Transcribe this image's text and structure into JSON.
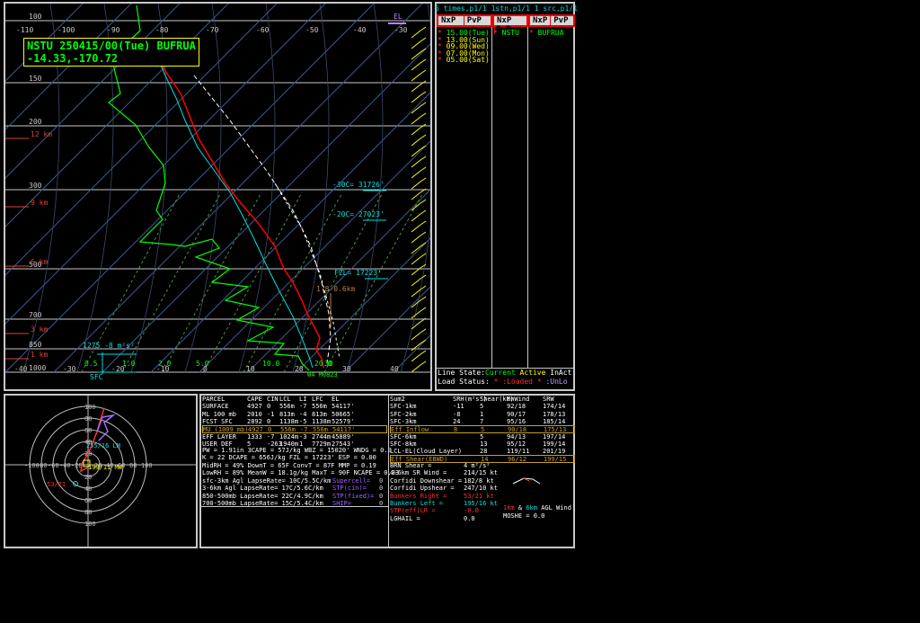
{
  "skewt": {
    "title_line1": "NSTU 250415/00(Tue) BUFRUA",
    "title_line2": "-14.33,-170.72",
    "temp_ticks": [
      "-110",
      "-100",
      "-90",
      "-80",
      "-70",
      "-60",
      "-50",
      "-40",
      "-30"
    ],
    "bottom_ticks": [
      "-40",
      "-30",
      "-20",
      "-10",
      "0",
      "10",
      "20",
      "30",
      "40"
    ],
    "pressure_labels": [
      "100",
      "150",
      "200",
      "300",
      "500",
      "700",
      "850",
      "1000"
    ],
    "height_labels": [
      "12 km",
      "9 km",
      "6 km",
      "3 km",
      "1 km"
    ],
    "sfc_label": "SFC",
    "mixing_ratios": [
      "0.5",
      "1.0",
      "2.0",
      "5.0",
      "10.0",
      "20.0",
      "30"
    ],
    "level_labels": [
      {
        "text": "-30C= 31726'"
      },
      {
        "text": "-20C= 27023'"
      },
      {
        "text": "FZL= 17223'"
      }
    ],
    "el_label": "EL",
    "eff_inflow_label": "1275  -8 m²s²",
    "layer_label": "1.8-0.6km",
    "sfc_val": "W4 M0823 ",
    "colors": {
      "temp": "#ff0000",
      "dew": "#00ff00",
      "wetbulb": "#00e0e0",
      "parcel": "#ffffff",
      "wind": "#ffff00"
    }
  },
  "rightlist": {
    "header": "5 times,p1/1 1stn,p1/1 1 src,p1/1",
    "buttons": [
      "NxP",
      "PvP",
      "NxP",
      "PvP",
      "NxP",
      "PvP"
    ],
    "times": [
      "15.00(Tue)",
      "13.00(Sun)",
      "09.00(Wed)",
      "07.00(Mon)",
      "05.00(Sat)"
    ],
    "station": "NSTU",
    "source": "BUFRUA",
    "line_state_label": "Line State:",
    "line_state_current": "Current",
    "line_state_active": "Active",
    "line_state_inact": "InAct",
    "load_status_label": "Load Status:",
    "load_loaded": ":Loaded",
    "load_unlo": ":UnLo"
  },
  "hodo": {
    "rings": [
      "20",
      "40",
      "60",
      "80",
      "100"
    ],
    "axis": [
      "-100",
      "-80",
      "-60",
      "-40",
      "-20",
      "20",
      "40",
      "60",
      "80",
      "100"
    ],
    "lm_label": "255/16 LM",
    "rm_label": "53/21 RM",
    "mean_label": "199/11 MW",
    "bunkers_label": "53/21"
  },
  "params": {
    "left_head": [
      "PARCEL",
      "CAPE",
      "CIN",
      "LCL",
      "LI",
      "LFC",
      "EL"
    ],
    "left_rows": [
      [
        "SURFACE",
        "4927",
        "0",
        "556m",
        "-7",
        "556m",
        "54117'"
      ],
      [
        "ML 100 mb",
        "2010",
        "-1",
        "813m",
        "-4",
        "813m",
        "50665'"
      ],
      [
        "FCST SFC",
        "2892",
        "0",
        "1138m",
        "-5",
        "1138m",
        "52579'"
      ],
      [
        "MU (1009 mb)",
        "4927",
        "0",
        "556m",
        "-7",
        "556m",
        "54117'"
      ],
      [
        "EFF LAYER",
        "1333",
        "-7",
        "1024m",
        "-3",
        "2744m",
        "45889'"
      ],
      [
        "USER DEF",
        "5",
        "-263",
        "1940m",
        "1",
        "7729m",
        "27543'"
      ]
    ],
    "misc_rows": [
      "PW = 1.91in  3CAPE = 57J/kg  WBZ = 15020'  WNDG = 0.0",
      "K = 22       DCAPE = 656J/kg  FZL = 17223'  ESP = 0.00",
      "MidRH = 49%  DownT = 65F   ConvT = 87F  MMP = 0.19",
      "LowRH = 89%  MeanW = 18.1g/kg  MaxT = 90F  NCAPE = 0.33"
    ],
    "lapse_rows": [
      "sfc-3km Agl LapseRate= 10C/5.5C/km",
      "3-6km Agl LapseRate= 17C/5.6C/km",
      "850-500mb LapseRate= 22C/4.9C/km",
      "700-500mb LapseRate= 15C/5.4C/km"
    ],
    "mid_labels": [
      "Supercell=",
      "STP(cin)=",
      "STP(fixed)=",
      "SHIP="
    ],
    "mid_vals": [
      "0",
      "0",
      "0",
      "0"
    ],
    "right_head": [
      "Sum2",
      "SRH(m²s²)",
      "Shear(kt)",
      "MnWind",
      "SRW"
    ],
    "right_rows": [
      [
        "SFC-1km",
        "-11",
        "5",
        "92/18",
        "174/14"
      ],
      [
        "SFC-2km",
        "-8",
        "1",
        "90/17",
        "178/13"
      ],
      [
        "SFC-3km",
        "24",
        "7",
        "95/16",
        "185/14"
      ],
      [
        "Eff Inflow",
        "8",
        "5",
        "90/18",
        "175/13"
      ],
      [
        "SFC-6km",
        "",
        "5",
        "94/13",
        "197/14"
      ],
      [
        "SFC-8km",
        "",
        "13",
        "95/12",
        "199/14"
      ],
      [
        "LCL-EL(Cloud Layer)",
        "",
        "28",
        "119/11",
        "201/19"
      ],
      [
        "Eff Shear(EBWD)",
        "",
        "14",
        "96/12",
        "199/15"
      ]
    ],
    "lower_rows": [
      [
        "BRN Shear =",
        "4 m²/s²"
      ],
      [
        "4-6km SR Wind =",
        "214/15 kt"
      ],
      [
        "Corfidi Downshear =",
        "182/8 kt"
      ],
      [
        "Corfidi Upshear =",
        "247/10 kt"
      ],
      [
        "Bunkers Right =",
        "53/21 kt"
      ],
      [
        "Bunkers Left =",
        "195/16 kt"
      ],
      [
        "STP(eff)LR =",
        "-0.0"
      ],
      [
        "LGHAIL =",
        "0.0"
      ]
    ],
    "legend_1km": "1km",
    "legend_and": "&",
    "legend_6km": "6km",
    "legend_agl": "AGL Wind",
    "moshe": "MOSHE = 0.0"
  }
}
